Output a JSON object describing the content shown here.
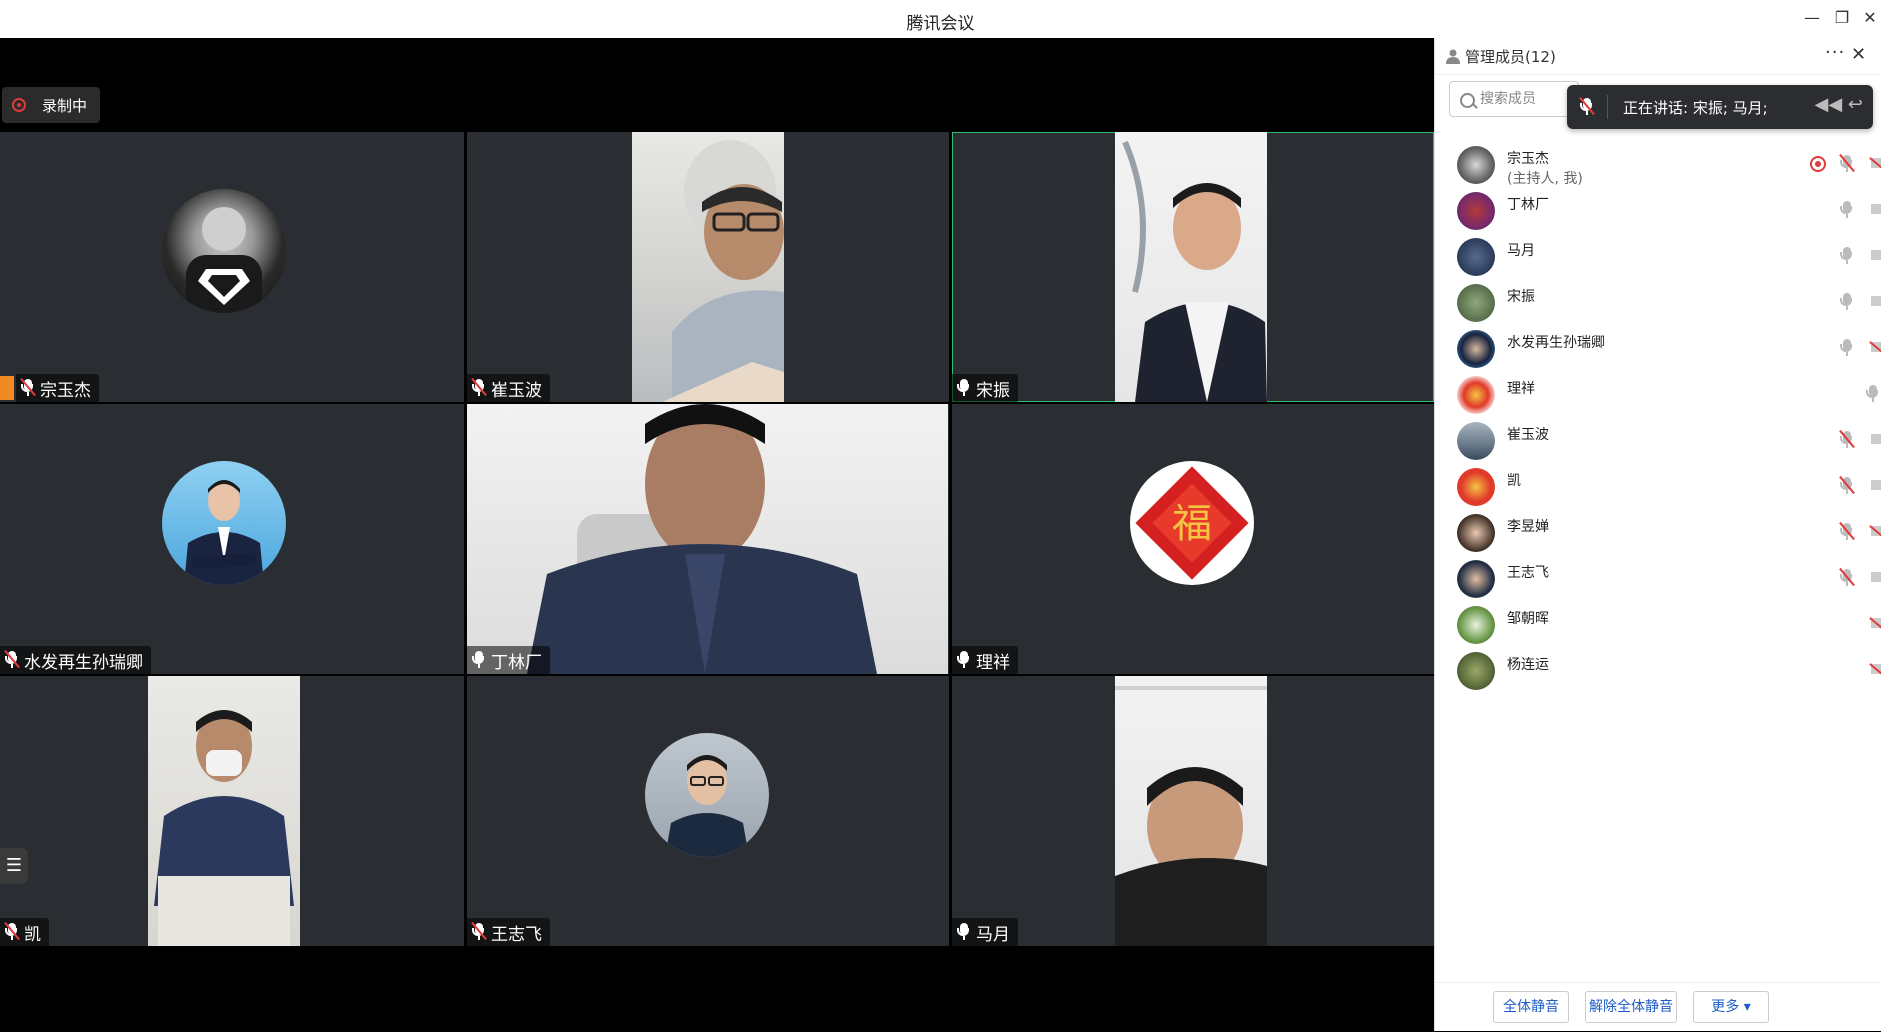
{
  "window": {
    "title": "腾讯会议"
  },
  "recording": {
    "label": "录制中"
  },
  "tiles": [
    {
      "name": "宗玉杰",
      "mic": "muted",
      "kind": "avatar"
    },
    {
      "name": "崔玉波",
      "mic": "muted",
      "kind": "camera"
    },
    {
      "name": "宋振",
      "mic": "on",
      "kind": "camera",
      "speaking": true
    },
    {
      "name": "水发再生孙瑞卿",
      "mic": "muted",
      "kind": "avatar"
    },
    {
      "name": "丁林厂",
      "mic": "on",
      "kind": "camera"
    },
    {
      "name": "理祥",
      "mic": "on",
      "kind": "avatar"
    },
    {
      "name": "凯",
      "mic": "muted",
      "kind": "camera"
    },
    {
      "name": "王志飞",
      "mic": "muted",
      "kind": "avatar"
    },
    {
      "name": "马月",
      "mic": "on",
      "kind": "camera"
    }
  ],
  "panel": {
    "title": "管理成员(12)",
    "search_placeholder": "搜索成员",
    "speaking_text": "正在讲话: 宋振; 马月;",
    "members": [
      {
        "name": "宗玉杰",
        "sub": "(主持人, 我)"
      },
      {
        "name": "丁林厂"
      },
      {
        "name": "马月"
      },
      {
        "name": "宋振"
      },
      {
        "name": "水发再生孙瑞卿"
      },
      {
        "name": "理祥"
      },
      {
        "name": "崔玉波"
      },
      {
        "name": "凯"
      },
      {
        "name": "李昱婵"
      },
      {
        "name": "王志飞"
      },
      {
        "name": "邹朝晖"
      },
      {
        "name": "杨连运"
      }
    ],
    "footer": {
      "mute_all": "全体静音",
      "unmute_all": "解除全体静音",
      "more": "更多 ▾"
    }
  },
  "colors": {
    "accent": "#2fbf71",
    "record": "#e03a3a",
    "link": "#1e5cc8"
  }
}
